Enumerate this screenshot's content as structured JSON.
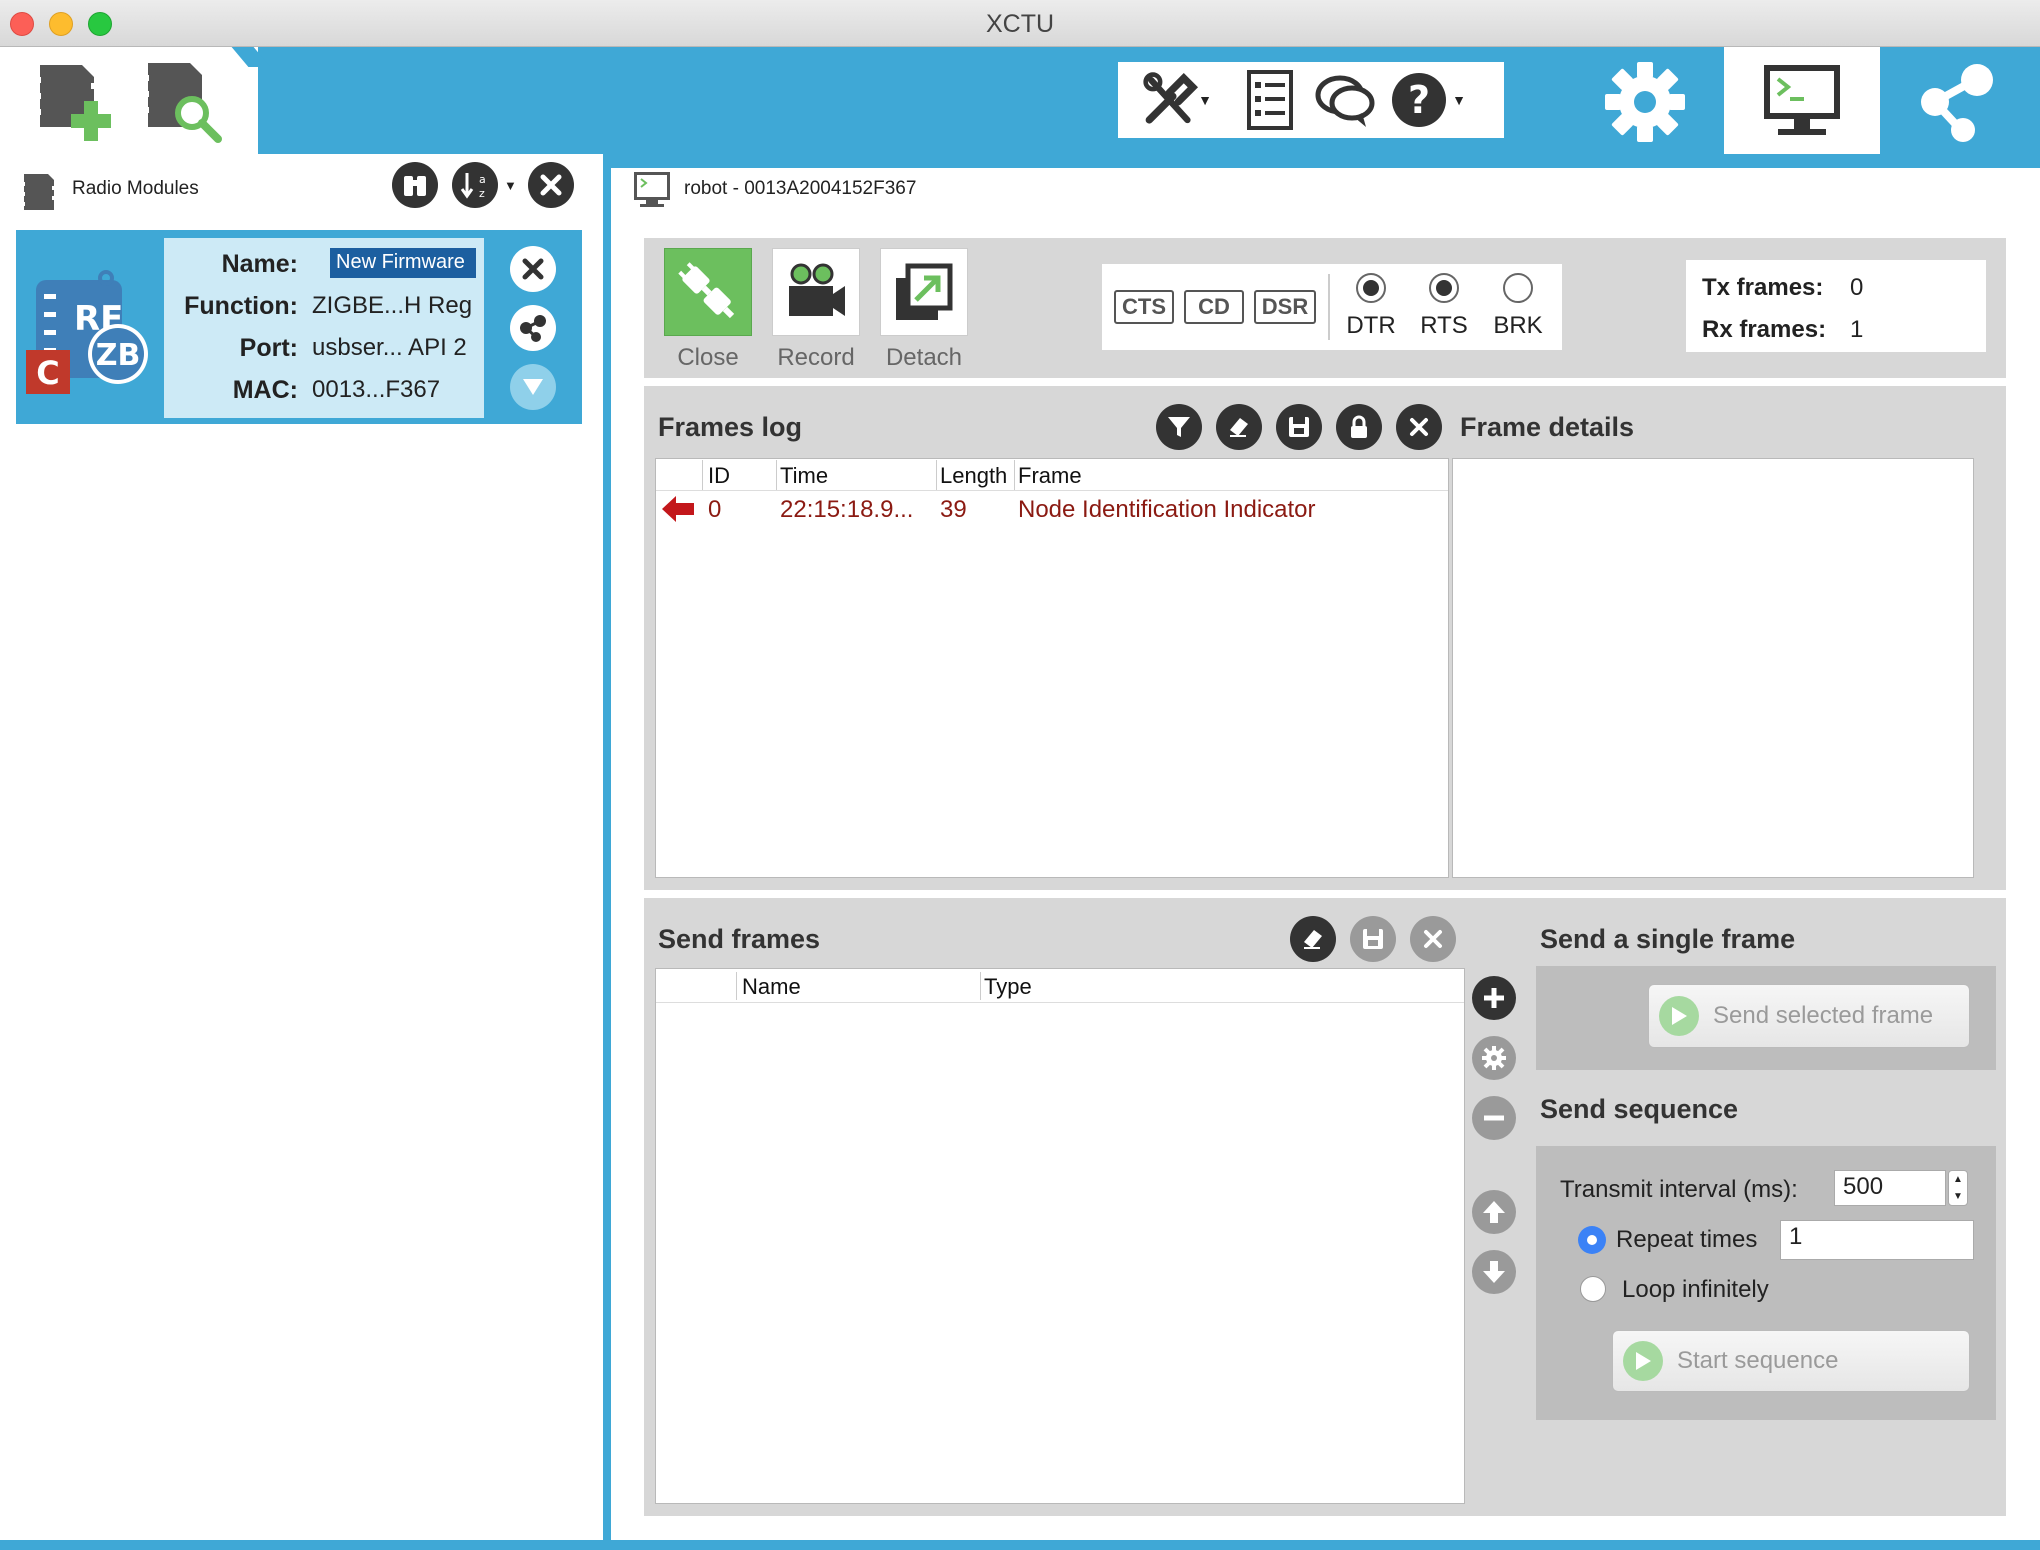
{
  "window": {
    "title": "XCTU"
  },
  "radio_modules": {
    "title": "Radio Modules",
    "module": {
      "name_label": "Name:",
      "name_value": "New Firmware",
      "function_label": "Function:",
      "function_value": "ZIGBE...H Reg",
      "port_label": "Port:",
      "port_value": "usbser... API 2",
      "mac_label": "MAC:",
      "mac_value": "0013...F367",
      "badge_c": "C",
      "badge_zb": "ZB",
      "badge_rf": "RF"
    }
  },
  "console": {
    "title": "robot - 0013A2004152F367",
    "buttons": {
      "close": "Close",
      "record": "Record",
      "detach": "Detach"
    },
    "signals": {
      "cts": "CTS",
      "cd": "CD",
      "dsr": "DSR",
      "dtr": "DTR",
      "rts": "RTS",
      "brk": "BRK"
    },
    "tx_label": "Tx frames:",
    "tx_value": "0",
    "rx_label": "Rx frames:",
    "rx_value": "1"
  },
  "frames_log": {
    "title": "Frames log",
    "details_title": "Frame details",
    "columns": {
      "id": "ID",
      "time": "Time",
      "length": "Length",
      "frame": "Frame"
    },
    "rows": [
      {
        "id": "0",
        "time": "22:15:18.9...",
        "length": "39",
        "frame": "Node Identification Indicator"
      }
    ]
  },
  "send_frames": {
    "title": "Send frames",
    "columns": {
      "name": "Name",
      "type": "Type"
    },
    "single_title": "Send a single frame",
    "send_selected": "Send selected frame",
    "sequence_title": "Send sequence",
    "interval_label": "Transmit interval (ms):",
    "interval_value": "500",
    "repeat_label": "Repeat times",
    "repeat_value": "1",
    "loop_label": "Loop infinitely",
    "start_sequence": "Start sequence"
  },
  "colors": {
    "accent": "#3fa8d6",
    "frame_text": "#8b1a12",
    "green": "#6cbf5e"
  }
}
